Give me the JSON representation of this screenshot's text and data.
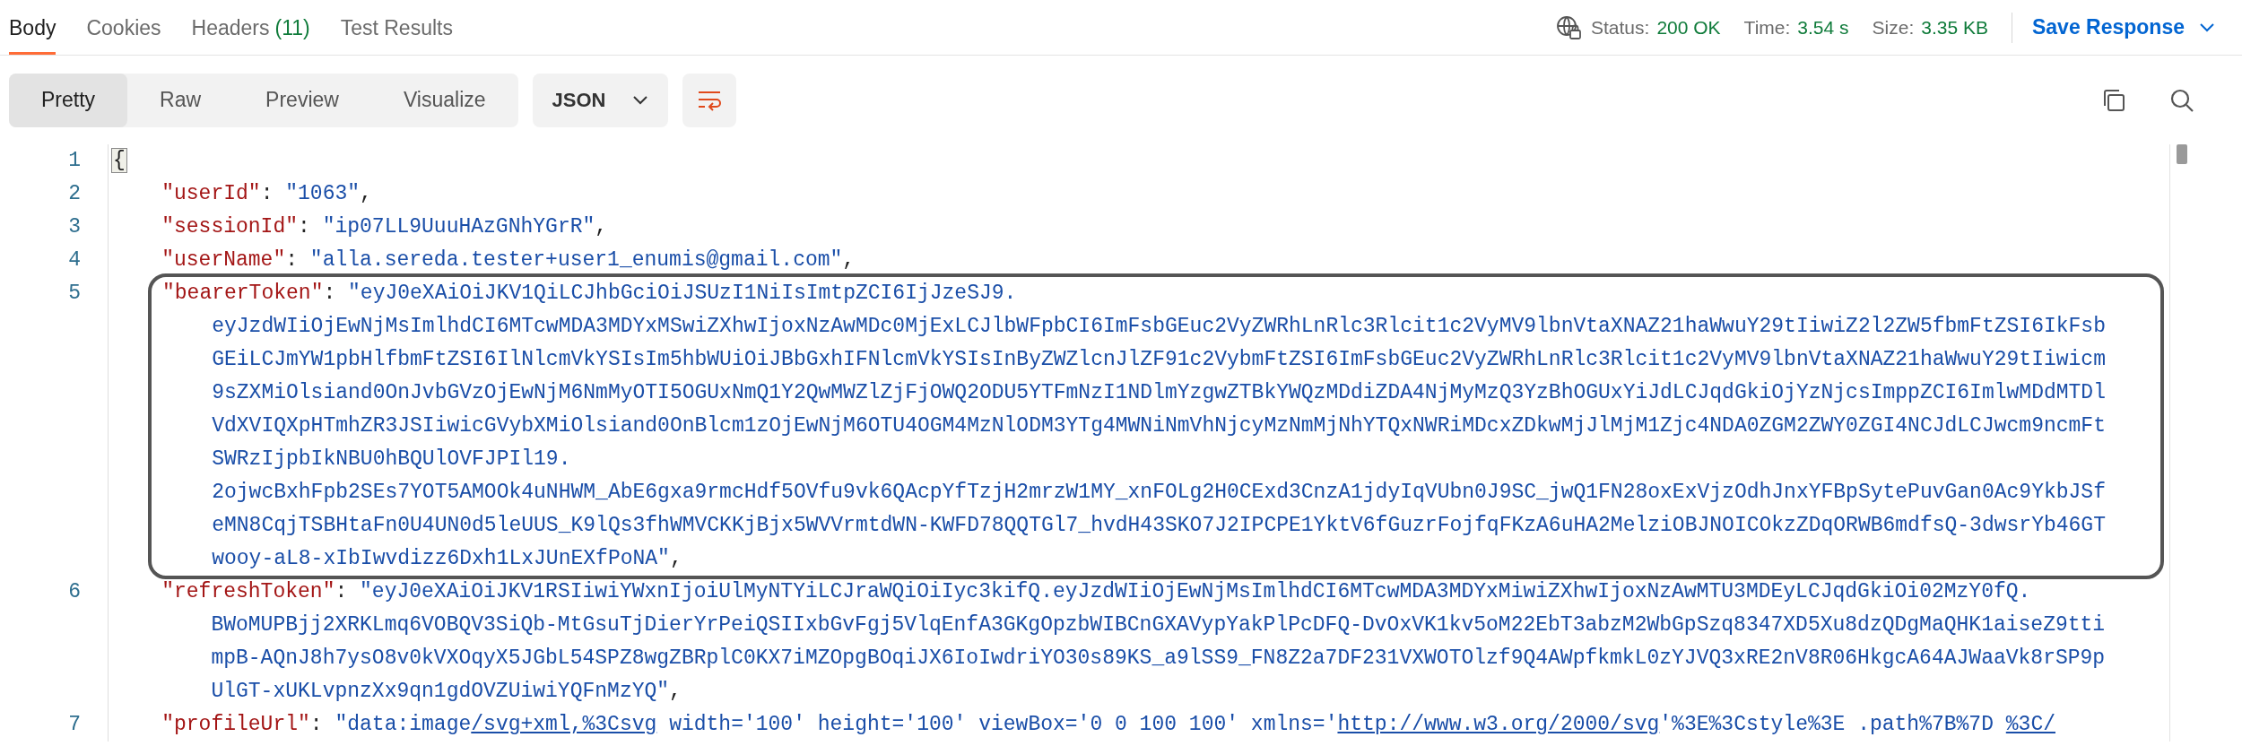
{
  "tabs": [
    {
      "label": "Body",
      "selected": true
    },
    {
      "label": "Cookies",
      "selected": false
    },
    {
      "label": "Headers",
      "count": "(11)",
      "selected": false
    },
    {
      "label": "Test Results",
      "selected": false
    }
  ],
  "status": [
    {
      "label": "Status:",
      "value": "200 OK"
    },
    {
      "label": "Time:",
      "value": "3.54 s"
    },
    {
      "label": "Size:",
      "value": "3.35 KB"
    }
  ],
  "save_button": "Save Response",
  "view_modes": [
    {
      "label": "Pretty",
      "selected": true
    },
    {
      "label": "Raw",
      "selected": false
    },
    {
      "label": "Preview",
      "selected": false
    },
    {
      "label": "Visualize",
      "selected": false
    }
  ],
  "format_dropdown": "JSON",
  "wrap_lines": {
    "on": true
  },
  "code": {
    "number": "1",
    "open": "{",
    "bracket_matched": true,
    "members": [
      {
        "number": "2",
        "kind": "text",
        "key": "\"userId\"",
        "sep": ": ",
        "value": [
          "\"1063\""
        ],
        "end": ",",
        "highlighted": false
      },
      {
        "number": "3",
        "kind": "text",
        "key": "\"sessionId\"",
        "sep": ": ",
        "value": [
          "\"ip07LL9UuuHAzGNhYGrR\""
        ],
        "end": ",",
        "highlighted": false
      },
      {
        "number": "4",
        "kind": "text",
        "key": "\"userName\"",
        "sep": ": ",
        "value": [
          "\"alla.sereda.tester+user1_enumis@gmail.com\""
        ],
        "end": ",",
        "highlighted": false
      },
      {
        "number": "5",
        "kind": "text",
        "key": "\"bearerToken\"",
        "sep": ": ",
        "value": [
          "\"eyJ0eXAiOiJKV1QiLCJhbGciOiJSUzI1NiIsImtpZCI6IjJzeSJ9.",
          "eyJzdWIiOjEwNjMsImlhdCI6MTcwMDA3MDYxMSwiZXhwIjoxNzAwMDc0MjExLCJlbWFpbCI6ImFsbGEuc2VyZWRhLnRlc3Rlcit1c2VyMV9lbnVtaXNAZ21haWwuY29tIiwiZ2l2ZW5fbmFtZSI6IkFsb",
          "GEiLCJmYW1pbHlfbmFtZSI6IlNlcmVkYSIsIm5hbWUiOiJBbGxhIFNlcmVkYSIsInByZWZlcnJlZF91c2VybmFtZSI6ImFsbGEuc2VyZWRhLnRlc3Rlcit1c2VyMV9lbnVtaXNAZ21haWwuY29tIiwicm",
          "9sZXMiOlsiand0OnJvbGVzOjEwNjM6NmMyOTI5OGUxNmQ1Y2QwMWZlZjFjOWQ2ODU5YTFmNzI1NDlmYzgwZTBkYWQzMDdiZDA4NjMyMzQ3YzBhOGUxYiJdLCJqdGkiOjYzNjcsImppZCI6ImlwMDdMTDl",
          "VdXVIQXpHTmhZR3JSIiwicGVybXMiOlsiand0OnBlcm1zOjEwNjM6OTU4OGM4MzNlODM3YTg4MWNiNmVhNjcyMzNmMjNhYTQxNWRiMDcxZDkwMjJlMjM1Zjc4NDA0ZGM2ZWY0ZGI4NCJdLCJwcm9ncmFt",
          "SWRzIjpbIkNBU0hBQUlOVFJPIl19.",
          "2ojwcBxhFpb2SEs7YOT5AMOOk4uNHWM_AbE6gxa9rmcHdf5OVfu9vk6QAcpYfTzjH2mrzW1MY_xnFOLg2H0CExd3CnzA1jdyIqVUbn0J9SC_jwQ1FN28oxExVjzOdhJnxYFBpSytePuvGan0Ac9YkbJSf",
          "eMN8CqjTSBHtaFn0U4UN0d5leUUS_K9lQs3fhWMVCKKjBjx5WVVrmtdWN-KWFD78QQTGl7_hvdH43SKO7J2IPCPE1YktV6fGuzrFojfqFKzA6uHA2MelziOBJNOICOkzZDqORWB6mdfsQ-3dwsrYb46GT",
          "wooy-aL8-xIbIwvdizz6Dxh1LxJUnEXfPoNA\""
        ],
        "end": ",",
        "highlighted": true
      },
      {
        "number": "6",
        "kind": "text",
        "key": "\"refreshToken\"",
        "sep": ": ",
        "value": [
          "\"eyJ0eXAiOiJKV1RSIiwiYWxnIjoiUlMyNTYiLCJraWQiOiIyc3kifQ.eyJzdWIiOjEwNjMsImlhdCI6MTcwMDA3MDYxMiwiZXhwIjoxNzAwMTU3MDEyLCJqdGkiOi02MzY0fQ.",
          "BWoMUPBjj2XRKLmq6VOBQV3SiQb-MtGsuTjDierYrPeiQSIIxbGvFgj5VlqEnfA3GKgOpzbWIBCnGXAVypYakPlPcDFQ-DvOxVK1kv5oM22EbT3abzM2WbGpSzq8347XD5Xu8dzQDgMaQHK1aiseZ9tti",
          "mpB-AQnJ8h7ysO8v0kVXOqyX5JGbL54SPZ8wgZBRplC0KX7iMZOpgBOqiJX6IoIwdriYO30s89KS_a9lSS9_FN8Z2a7DF231VXWOTOlzf9Q4AWpfkmkL0zYJVQ3xRE2nV8R06HkgcA64AJWaaVk8rSP9p",
          "UlGT-xUKLvpnzXx9qn1gdOVZUiwiYQFnMzYQ\""
        ],
        "end": ",",
        "highlighted": false
      },
      {
        "number": "7",
        "kind": "linked",
        "key": "\"profileUrl\"",
        "sep": ": ",
        "segments": [
          {
            "text": "\"data:image",
            "link": false
          },
          {
            "text": "/svg+xml,%3Csvg",
            "link": true
          },
          {
            "text": " width='100' height='100' viewBox='0 0 100 100' xmlns='",
            "link": false
          },
          {
            "text": "http://www.w3.org/2000/svg",
            "link": true
          },
          {
            "text": "'%3E%3Cstyle%3E .path%7B%7D ",
            "link": false
          },
          {
            "text": "%3C/",
            "link": true
          }
        ],
        "highlighted": false
      }
    ]
  }
}
